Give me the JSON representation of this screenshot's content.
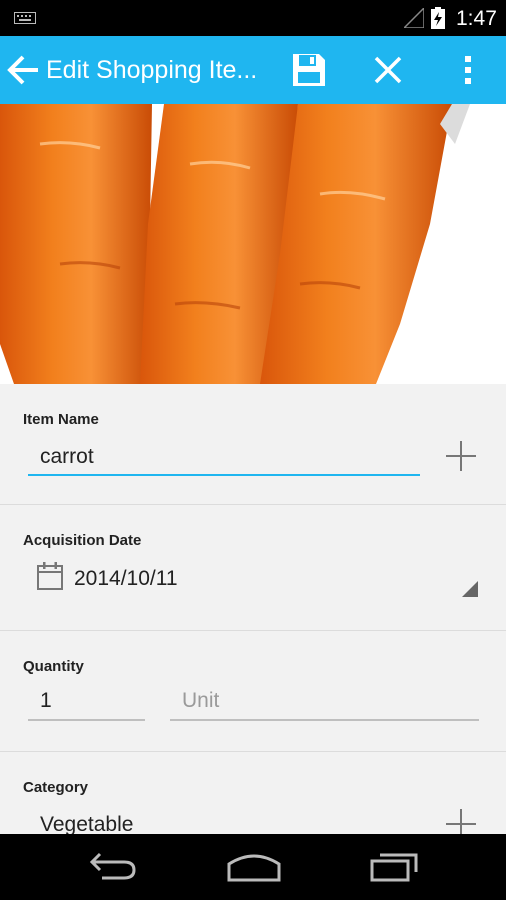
{
  "status_bar": {
    "time": "1:47"
  },
  "action_bar": {
    "title": "Edit Shopping Ite..."
  },
  "form": {
    "item_name": {
      "label": "Item Name",
      "value": "carrot"
    },
    "acquisition_date": {
      "label": "Acquisition Date",
      "value": "2014/10/11"
    },
    "quantity": {
      "label": "Quantity",
      "value": "1",
      "unit_placeholder": "Unit"
    },
    "category": {
      "label": "Category",
      "value": "Vegetable"
    }
  },
  "colors": {
    "accent": "#1fb6f0",
    "status_bar": "#000000",
    "background": "#f2f2f2"
  }
}
